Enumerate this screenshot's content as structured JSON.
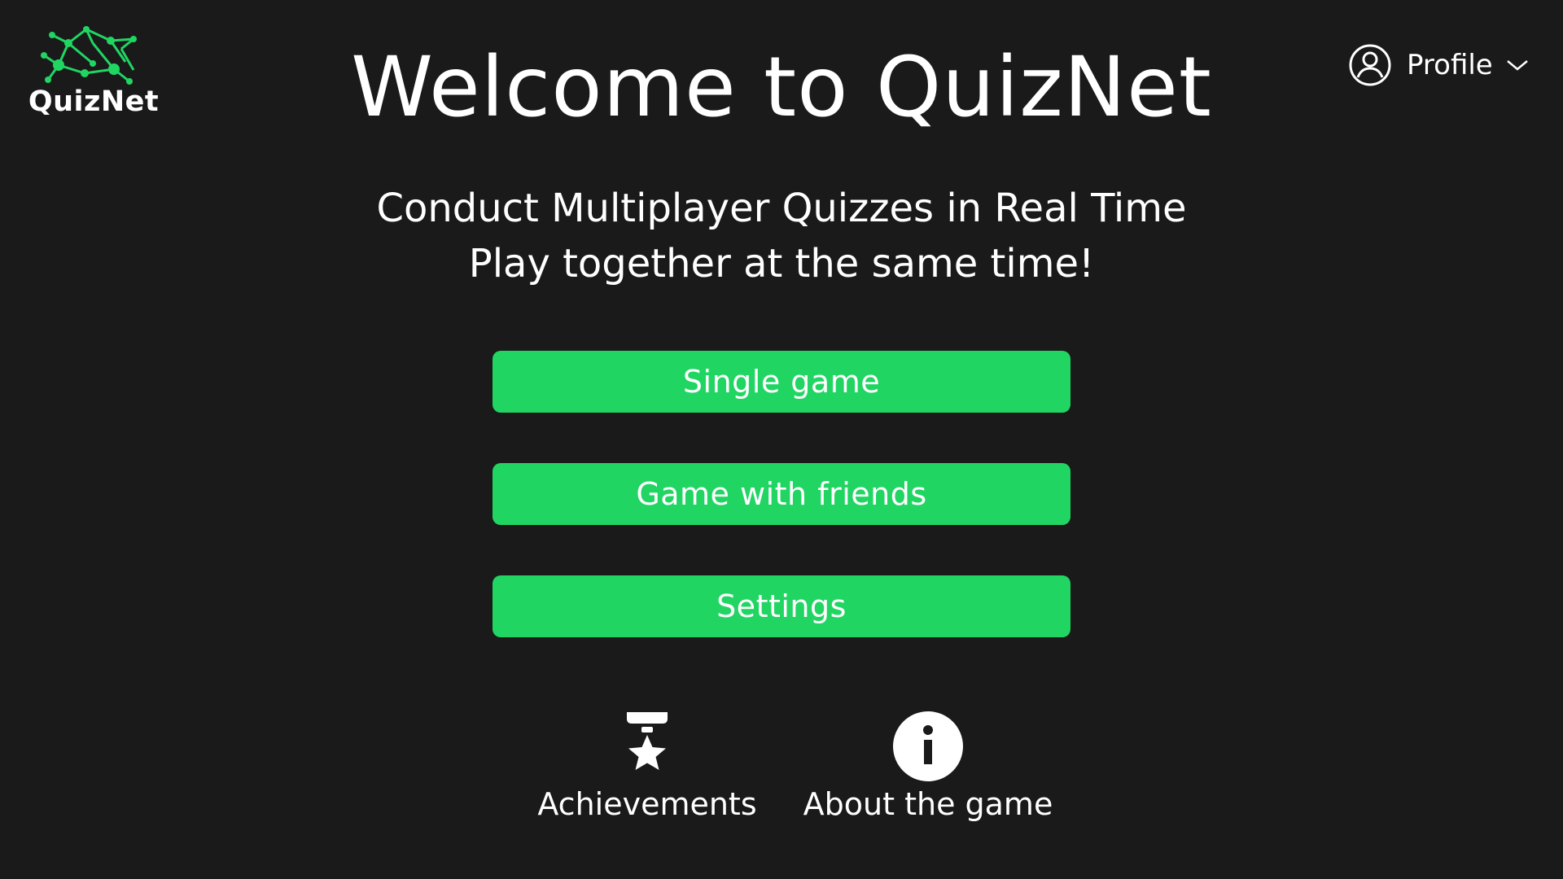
{
  "app": {
    "logo_text": "QuizNet",
    "title": "Welcome to QuizNet",
    "subtitle_line1": "Conduct Multiplayer Quizzes in Real Time",
    "subtitle_line2": "Play together at the same time!"
  },
  "header": {
    "profile_label": "Profile",
    "profile_icon": "user-circle-icon",
    "dropdown_icon": "chevron-down-icon"
  },
  "menu": {
    "single_game": "Single game",
    "game_with_friends": "Game with friends",
    "settings": "Settings"
  },
  "footer": {
    "achievements_label": "Achievements",
    "achievements_icon": "medal-star-icon",
    "about_label": "About the game",
    "about_icon": "info-icon"
  },
  "colors": {
    "background": "#1a1a1a",
    "accent": "#21d563",
    "text": "#ffffff"
  }
}
